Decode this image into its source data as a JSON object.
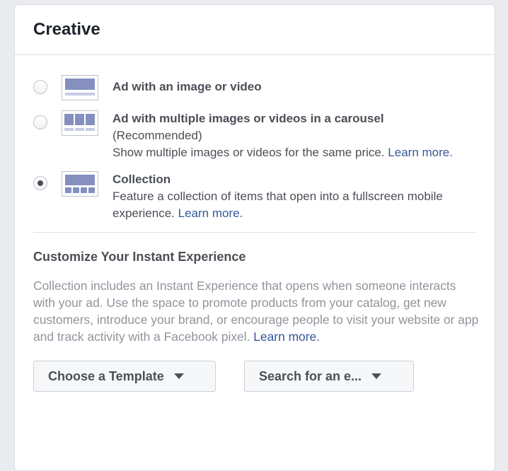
{
  "panel": {
    "title": "Creative"
  },
  "options": [
    {
      "title": "Ad with an image or video",
      "selected": false,
      "icon": "single-image-thumbnail-icon"
    },
    {
      "title": "Ad with multiple images or videos in a carousel",
      "note": "(Recommended)",
      "description": "Show multiple images or videos for the same price.",
      "link": "Learn more.",
      "selected": false,
      "icon": "carousel-thumbnail-icon"
    },
    {
      "title": "Collection",
      "description": "Feature a collection of items that open into a fullscreen mobile experience.",
      "link": "Learn more.",
      "selected": true,
      "icon": "collection-thumbnail-icon"
    }
  ],
  "instant_experience": {
    "title": "Customize Your Instant Experience",
    "description": "Collection includes an Instant Experience that opens when someone interacts with your ad. Use the space to promote products from your catalog, get new customers, introduce your brand, or encourage people to visit your website or app and track activity with a Facebook pixel.",
    "link": "Learn more."
  },
  "buttons": {
    "choose_template": "Choose a Template",
    "search": "Search for an e..."
  },
  "colors": {
    "link": "#365899",
    "thumbnail_block": "#8590c0",
    "text": "#4b4f56",
    "muted_text": "#90949c"
  }
}
